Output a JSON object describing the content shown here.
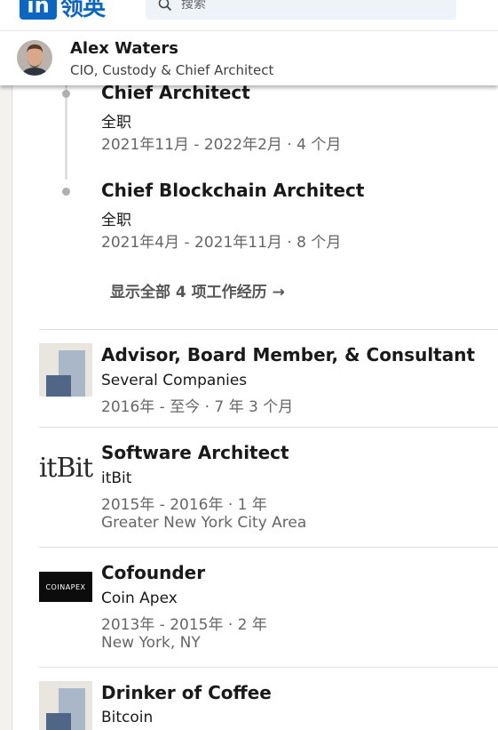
{
  "nav": {
    "logo_text": "领英",
    "logo_in": "in",
    "search_placeholder": "搜索"
  },
  "profile_bar": {
    "name": "Alex Waters",
    "headline": "CIO, Custody & Chief Architect"
  },
  "grouped_roles": [
    {
      "title": "Chief Architect",
      "type": "全职",
      "dates": "2021年11月 - 2022年2月 · 4 个月"
    },
    {
      "title": "Chief Blockchain Architect",
      "type": "全职",
      "dates": "2021年4月 - 2021年11月 · 8 个月"
    }
  ],
  "show_all_label": "显示全部 4 项工作经历 →",
  "experiences": [
    {
      "title": "Advisor, Board Member, & Consultant",
      "company": "Several Companies",
      "dates": "2016年 - 至今 · 7 年 3 个月",
      "location": ""
    },
    {
      "title": "Software Architect",
      "company": "itBit",
      "dates": "2015年 - 2016年 · 1 年",
      "location": "Greater New York City Area",
      "logo_text": "itBit"
    },
    {
      "title": "Cofounder",
      "company": "Coin Apex",
      "dates": "2013年 - 2015年 · 2 年",
      "location": "New York, NY",
      "logo_text": "COINAPEX"
    },
    {
      "title": "Drinker of Coffee",
      "company": "Bitcoin"
    }
  ],
  "colors": {
    "brand": "#0a66c2",
    "text": "#191919",
    "meta": "#666666"
  }
}
